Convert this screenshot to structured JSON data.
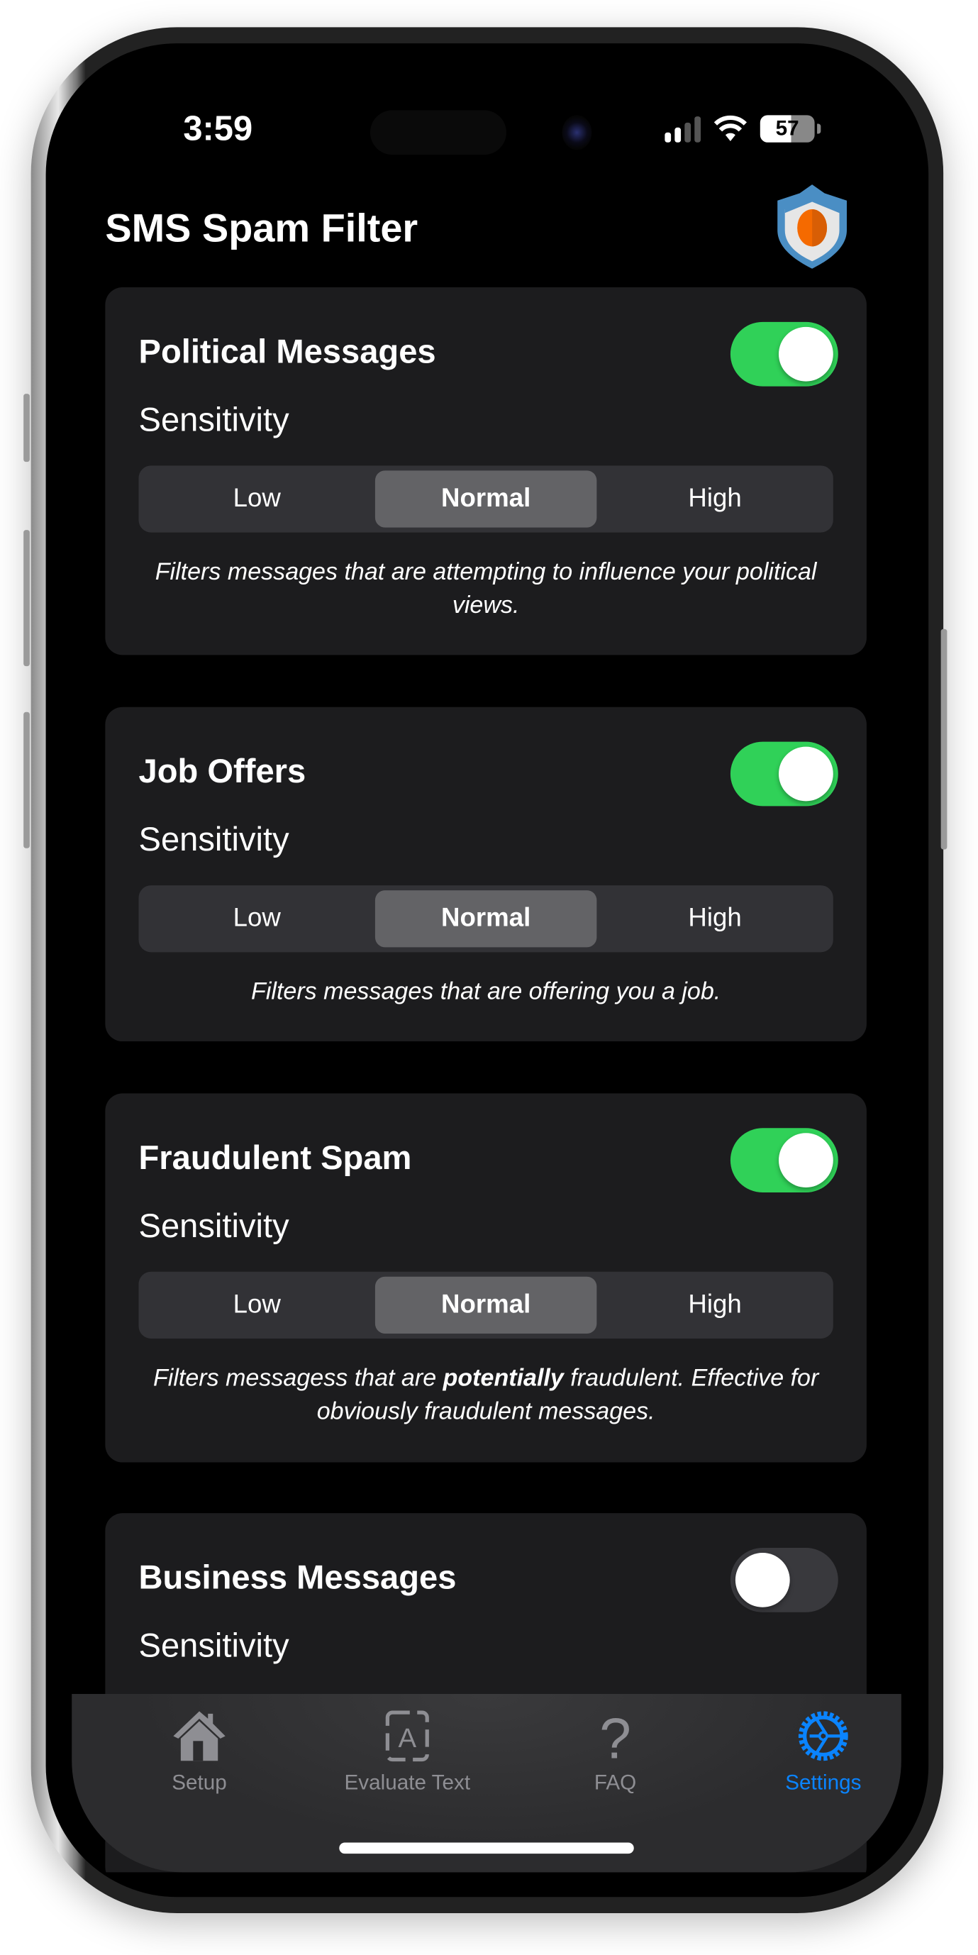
{
  "status_bar": {
    "time": "3:59",
    "battery": "57"
  },
  "header": {
    "title": "SMS Spam Filter",
    "logo_icon": "shield-icon"
  },
  "colors": {
    "accent": "#0a84ff",
    "toggle_on": "#30d158",
    "card_bg": "#1c1c1e",
    "logo_blue": "#4a8ec4",
    "logo_orange": "#f56a00"
  },
  "cards": [
    {
      "title": "Political Messages",
      "enabled": true,
      "sensitivity_label": "Sensitivity",
      "options": [
        "Low",
        "Normal",
        "High"
      ],
      "selected": "Normal",
      "desc_before": "Filters messages that are attempting to influence your political views.",
      "desc_bold": "",
      "desc_after": ""
    },
    {
      "title": "Job Offers",
      "enabled": true,
      "sensitivity_label": "Sensitivity",
      "options": [
        "Low",
        "Normal",
        "High"
      ],
      "selected": "Normal",
      "desc_before": "Filters messages that are offering you a job.",
      "desc_bold": "",
      "desc_after": ""
    },
    {
      "title": "Fraudulent Spam",
      "enabled": true,
      "sensitivity_label": "Sensitivity",
      "options": [
        "Low",
        "Normal",
        "High"
      ],
      "selected": "Normal",
      "desc_before": "Filters messagess that are ",
      "desc_bold": "potentially",
      "desc_after": " fraudulent. Effective for obviously fraudulent messages."
    },
    {
      "title": "Business Messages",
      "enabled": false,
      "sensitivity_label": "Sensitivity"
    }
  ],
  "tabs": [
    {
      "label": "Setup",
      "icon": "house-icon"
    },
    {
      "label": "Evaluate Text",
      "icon": "text-box-icon"
    },
    {
      "label": "FAQ",
      "icon": "question-mark-icon"
    },
    {
      "label": "Settings",
      "icon": "gear-icon",
      "active": true
    }
  ]
}
